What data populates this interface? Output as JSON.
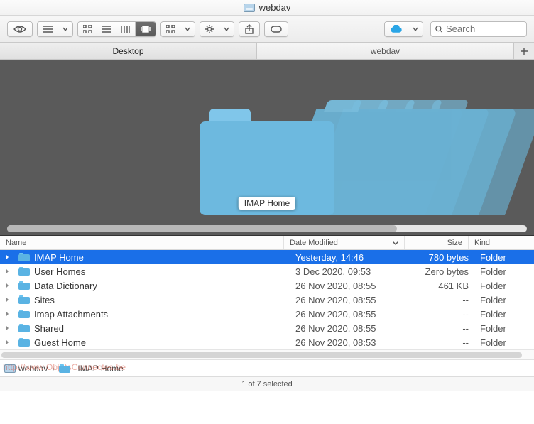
{
  "window": {
    "title": "webdav"
  },
  "search": {
    "placeholder": "Search"
  },
  "tabs": [
    {
      "label": "Desktop"
    },
    {
      "label": "webdav"
    }
  ],
  "preview": {
    "focused_label": "IMAP Home"
  },
  "columns": {
    "name": "Name",
    "date": "Date Modified",
    "size": "Size",
    "kind": "Kind"
  },
  "rows": [
    {
      "name": "IMAP Home",
      "date": "Yesterday, 14:46",
      "size": "780 bytes",
      "kind": "Folder",
      "selected": true
    },
    {
      "name": "User Homes",
      "date": "3 Dec 2020, 09:53",
      "size": "Zero bytes",
      "kind": "Folder",
      "selected": false
    },
    {
      "name": "Data Dictionary",
      "date": "26 Nov 2020, 08:55",
      "size": "461 KB",
      "kind": "Folder",
      "selected": false
    },
    {
      "name": "Sites",
      "date": "26 Nov 2020, 08:55",
      "size": "--",
      "kind": "Folder",
      "selected": false
    },
    {
      "name": "Imap Attachments",
      "date": "26 Nov 2020, 08:55",
      "size": "--",
      "kind": "Folder",
      "selected": false
    },
    {
      "name": "Shared",
      "date": "26 Nov 2020, 08:55",
      "size": "--",
      "kind": "Folder",
      "selected": false
    },
    {
      "name": "Guest Home",
      "date": "26 Nov 2020, 08:53",
      "size": "--",
      "kind": "Folder",
      "selected": false
    }
  ],
  "path": [
    {
      "label": "webdav",
      "icon": "disk"
    },
    {
      "label": "IMAP Home",
      "icon": "folder"
    }
  ],
  "status": "1 of 7 selected",
  "watermark": "http://www.ObjetsConnectes.be"
}
